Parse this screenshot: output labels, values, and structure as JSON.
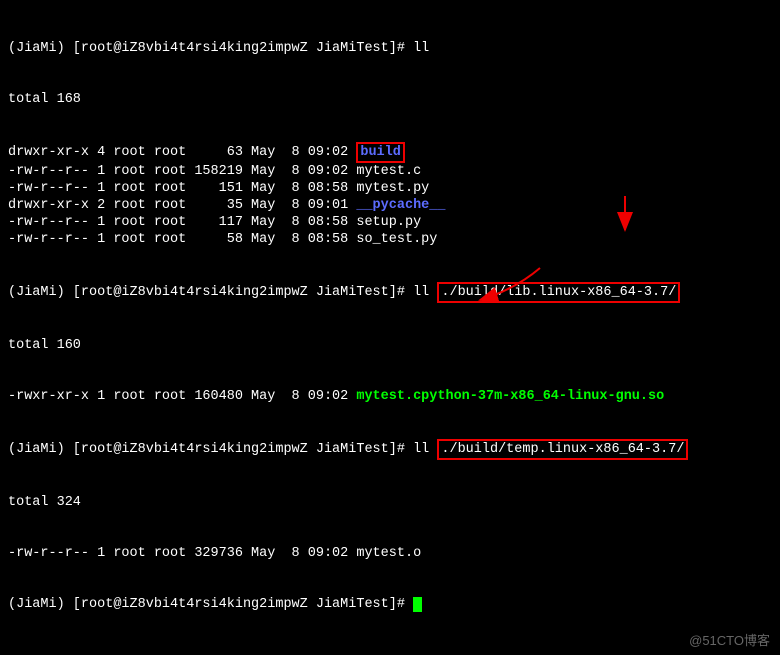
{
  "prompt1": "(JiaMi) [root@iZ8vbi4t4rsi4king2impwZ JiaMiTest]# ll",
  "total1": "total 168",
  "ls1": [
    {
      "perm": "drwxr-xr-x",
      "n": "4",
      "u": "root",
      "g": "root",
      "sz": "    63",
      "mo": "May",
      "d": " 8",
      "t": "09:02",
      "name": "build",
      "type": "dir",
      "boxed": true
    },
    {
      "perm": "-rw-r--r--",
      "n": "1",
      "u": "root",
      "g": "root",
      "sz": "158219",
      "mo": "May",
      "d": " 8",
      "t": "09:02",
      "name": "mytest.c",
      "type": "file"
    },
    {
      "perm": "-rw-r--r--",
      "n": "1",
      "u": "root",
      "g": "root",
      "sz": "   151",
      "mo": "May",
      "d": " 8",
      "t": "08:58",
      "name": "mytest.py",
      "type": "file"
    },
    {
      "perm": "drwxr-xr-x",
      "n": "2",
      "u": "root",
      "g": "root",
      "sz": "    35",
      "mo": "May",
      "d": " 8",
      "t": "09:01",
      "name": "__pycache__",
      "type": "dir"
    },
    {
      "perm": "-rw-r--r--",
      "n": "1",
      "u": "root",
      "g": "root",
      "sz": "   117",
      "mo": "May",
      "d": " 8",
      "t": "08:58",
      "name": "setup.py",
      "type": "file"
    },
    {
      "perm": "-rw-r--r--",
      "n": "1",
      "u": "root",
      "g": "root",
      "sz": "    58",
      "mo": "May",
      "d": " 8",
      "t": "08:58",
      "name": "so_test.py",
      "type": "file"
    }
  ],
  "prompt2_prefix": "(JiaMi) [root@iZ8vbi4t4rsi4king2impwZ JiaMiTest]# ll ",
  "path2": "./build/lib.linux-x86_64-3.7/",
  "total2": "total 160",
  "ls2": [
    {
      "perm": "-rwxr-xr-x",
      "n": "1",
      "u": "root",
      "g": "root",
      "sz": "160480",
      "mo": "May",
      "d": " 8",
      "t": "09:02",
      "name": "mytest.cpython-37m-x86_64-linux-gnu.so",
      "type": "exe"
    }
  ],
  "prompt3_prefix": "(JiaMi) [root@iZ8vbi4t4rsi4king2impwZ JiaMiTest]# ll ",
  "path3": "./build/temp.linux-x86_64-3.7/",
  "total3": "total 324",
  "ls3": [
    {
      "perm": "-rw-r--r--",
      "n": "1",
      "u": "root",
      "g": "root",
      "sz": "329736",
      "mo": "May",
      "d": " 8",
      "t": "09:02",
      "name": "mytest.o",
      "type": "file"
    }
  ],
  "prompt4": "(JiaMi) [root@iZ8vbi4t4rsi4king2impwZ JiaMiTest]# ",
  "watermark": "@51CTO博客"
}
